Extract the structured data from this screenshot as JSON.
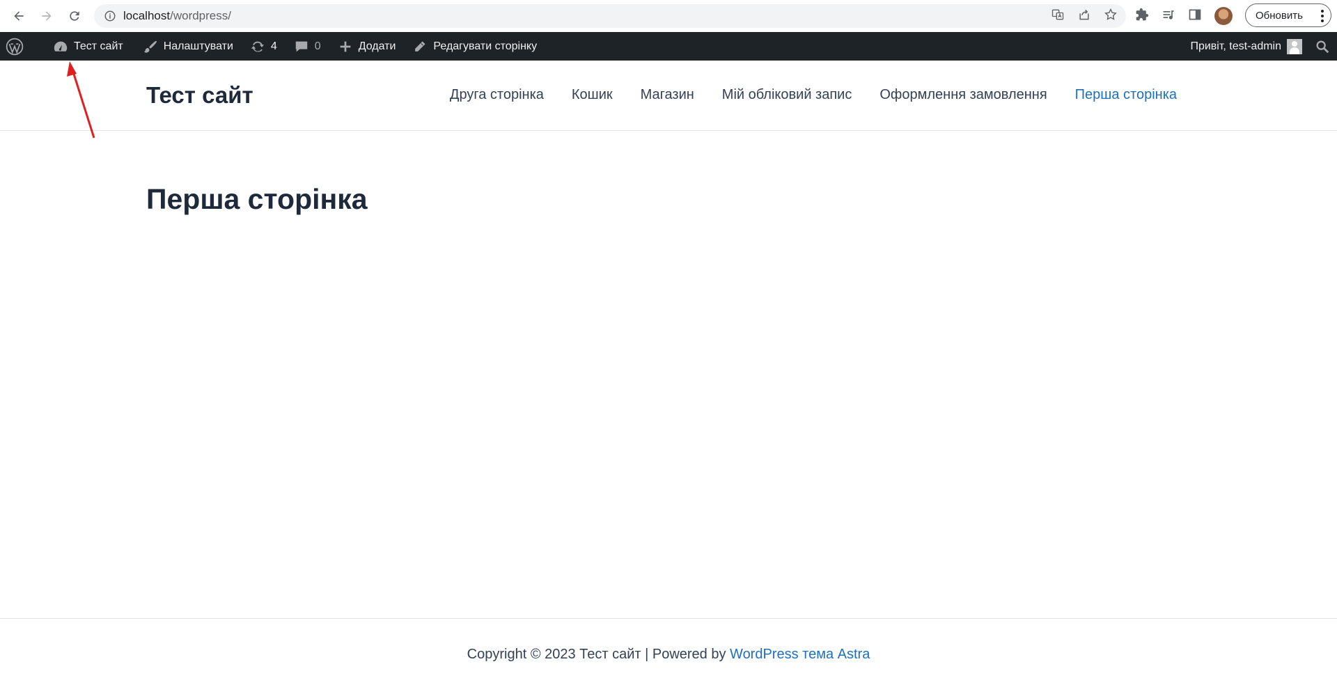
{
  "browser": {
    "url_host": "localhost",
    "url_path": "/wordpress/",
    "update_button": "Обновить"
  },
  "adminbar": {
    "site_name": "Тест сайт",
    "customize": "Налаштувати",
    "updates_count": "4",
    "comments_count": "0",
    "add_new": "Додати",
    "edit_page": "Редагувати сторінку",
    "greeting": "Привіт, test-admin"
  },
  "site": {
    "title": "Тест сайт",
    "menu": [
      "Друга сторінка",
      "Кошик",
      "Магазин",
      "Мій обліковий запис",
      "Оформлення замовлення",
      "Перша сторінка"
    ]
  },
  "page": {
    "title": "Перша сторінка"
  },
  "footer": {
    "prefix": "Copyright © 2023 Тест сайт | Powered by ",
    "link": "WordPress тема Astra"
  },
  "colors": {
    "adminbar_bg": "#1d2327",
    "link": "#1e6fbf",
    "annotation_arrow": "#e02020"
  },
  "icons": [
    "back-arrow-icon",
    "forward-arrow-icon",
    "reload-icon",
    "info-icon",
    "translate-icon",
    "share-icon",
    "star-icon",
    "extensions-icon",
    "media-icon",
    "sidepanel-icon",
    "wordpress-logo-icon",
    "dashboard-icon",
    "brush-icon",
    "updates-icon",
    "comment-icon",
    "plus-icon",
    "pencil-icon",
    "search-icon"
  ]
}
